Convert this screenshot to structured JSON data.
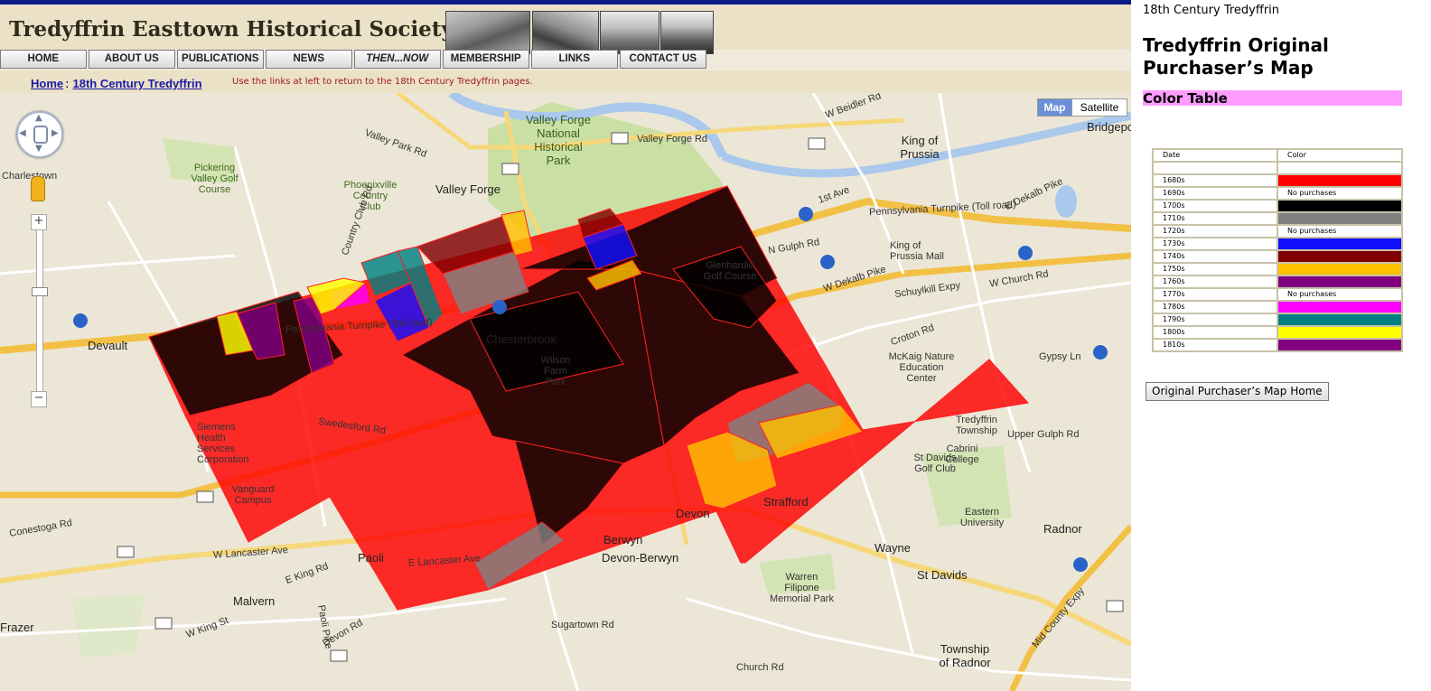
{
  "site": {
    "title": "Tredyffrin Easttown Historical Society",
    "nav": [
      "HOME",
      "ABOUT US",
      "PUBLICATIONS",
      "NEWS",
      "THEN...NOW",
      "MEMBERSHIP",
      "LINKS",
      "CONTACT US"
    ],
    "breadcrumb": {
      "home": "Home",
      "sep": ":",
      "current": "18th Century Tredyffrin"
    },
    "note": "Use the links at left to return to the 18th Century Tredyffrin pages."
  },
  "map": {
    "type_buttons": {
      "map": "Map",
      "satellite": "Satellite"
    },
    "zoom": {
      "in": "+",
      "out": "−"
    },
    "places": {
      "valley_forge_park": "Valley Forge National Historical Park",
      "valley_forge": "Valley Forge",
      "king_of_prussia": "King of Prussia",
      "bridgeport": "Bridgeport",
      "charlestown": "Charlestown",
      "pickering": "Pickering Valley Golf Course",
      "phoenixville_cc": "Phoenixville Country Club",
      "chesterbrook": "Chesterbrook",
      "wilson_farm": "Wilson Farm Park",
      "glenhardie": "Glenhardie Golf Course",
      "kop_mall": "King of Prussia Mall",
      "mckaig": "McKaig Nature Education Center",
      "devault": "Devault",
      "siemens": "Siemens Health Services Corporation",
      "vanguard": "Vanguard Campus",
      "devon": "Devon",
      "berwyn": "Berwyn",
      "devon_berwyn": "Devon-Berwyn",
      "strafford": "Strafford",
      "wayne": "Wayne",
      "st_davids": "St Davids",
      "paoli": "Paoli",
      "malvern": "Malvern",
      "frazer": "Frazer",
      "radnor": "Radnor",
      "twp_radnor": "Township of Radnor",
      "tredyffrin_twp": "Tredyffrin Township",
      "cabrini": "Cabrini College",
      "eastern": "Eastern University",
      "warren": "Warren Filipone Memorial Park",
      "st_davids_gc": "St Davids Golf Club",
      "penn_tpk": "Pennsylvania Turnpike (Toll road)",
      "schuylkill": "Schuylkill Expy",
      "w_dekalb": "W Dekalb Pike",
      "e_dekalb": "E Dekalb Pike",
      "swedesford": "Swedesford Rd",
      "w_lancaster": "W Lancaster Ave",
      "e_lancaster": "E Lancaster Ave",
      "conestoga": "Conestoga Rd",
      "sugartown": "Sugartown Rd",
      "croton": "Croton Rd",
      "valley_forge_rd": "Valley Forge Rd",
      "upper_gulph": "Upper Gulph Rd",
      "gypsy": "Gypsy Ln",
      "1st_ave": "1st Ave",
      "n_gulph": "N Gulph Rd",
      "church": "W Church Rd",
      "w_beidler": "W Beidler Rd",
      "w_king": "W King St",
      "e_king": "E King Rd",
      "devon_rd": "Devon Rd",
      "paoli_pike": "Paoli Pike",
      "church_rd": "Church Rd",
      "mid_county": "Mid County Expy",
      "valley_park": "Valley Park Rd",
      "country_club": "Country Club Rd"
    },
    "shields": [
      "23",
      "23",
      "23",
      "252",
      "252",
      "252",
      "202",
      "202",
      "202",
      "202",
      "76",
      "76",
      "76",
      "276",
      "276",
      "29",
      "29",
      "30",
      "30",
      "30",
      "401",
      "476",
      "320"
    ]
  },
  "sidebar": {
    "section": "18th Century Tredyffrin",
    "title": "Tredyffrin Original Purchaser’s Map",
    "color_table_heading": "Color Table",
    "table_headers": [
      "Date",
      "Color"
    ],
    "rows": [
      {
        "date": "",
        "color": "#ffffff",
        "label": ""
      },
      {
        "date": "1680s",
        "color": "#ff0000",
        "label": ""
      },
      {
        "date": "1690s",
        "color": "#ffffff",
        "label": "No purchases"
      },
      {
        "date": "1700s",
        "color": "#000000",
        "label": ""
      },
      {
        "date": "1710s",
        "color": "#808080",
        "label": ""
      },
      {
        "date": "1720s",
        "color": "#ffffff",
        "label": "No purchases"
      },
      {
        "date": "1730s",
        "color": "#1010ff",
        "label": ""
      },
      {
        "date": "1740s",
        "color": "#800000",
        "label": ""
      },
      {
        "date": "1750s",
        "color": "#ffc000",
        "label": ""
      },
      {
        "date": "1760s",
        "color": "#800080",
        "label": ""
      },
      {
        "date": "1770s",
        "color": "#ffffff",
        "label": "No purchases"
      },
      {
        "date": "1780s",
        "color": "#ff00ff",
        "label": ""
      },
      {
        "date": "1790s",
        "color": "#008080",
        "label": ""
      },
      {
        "date": "1800s",
        "color": "#ffff00",
        "label": ""
      },
      {
        "date": "1810s",
        "color": "#800080",
        "label": ""
      }
    ],
    "home_button": "Original Purchaser’s Map Home"
  }
}
